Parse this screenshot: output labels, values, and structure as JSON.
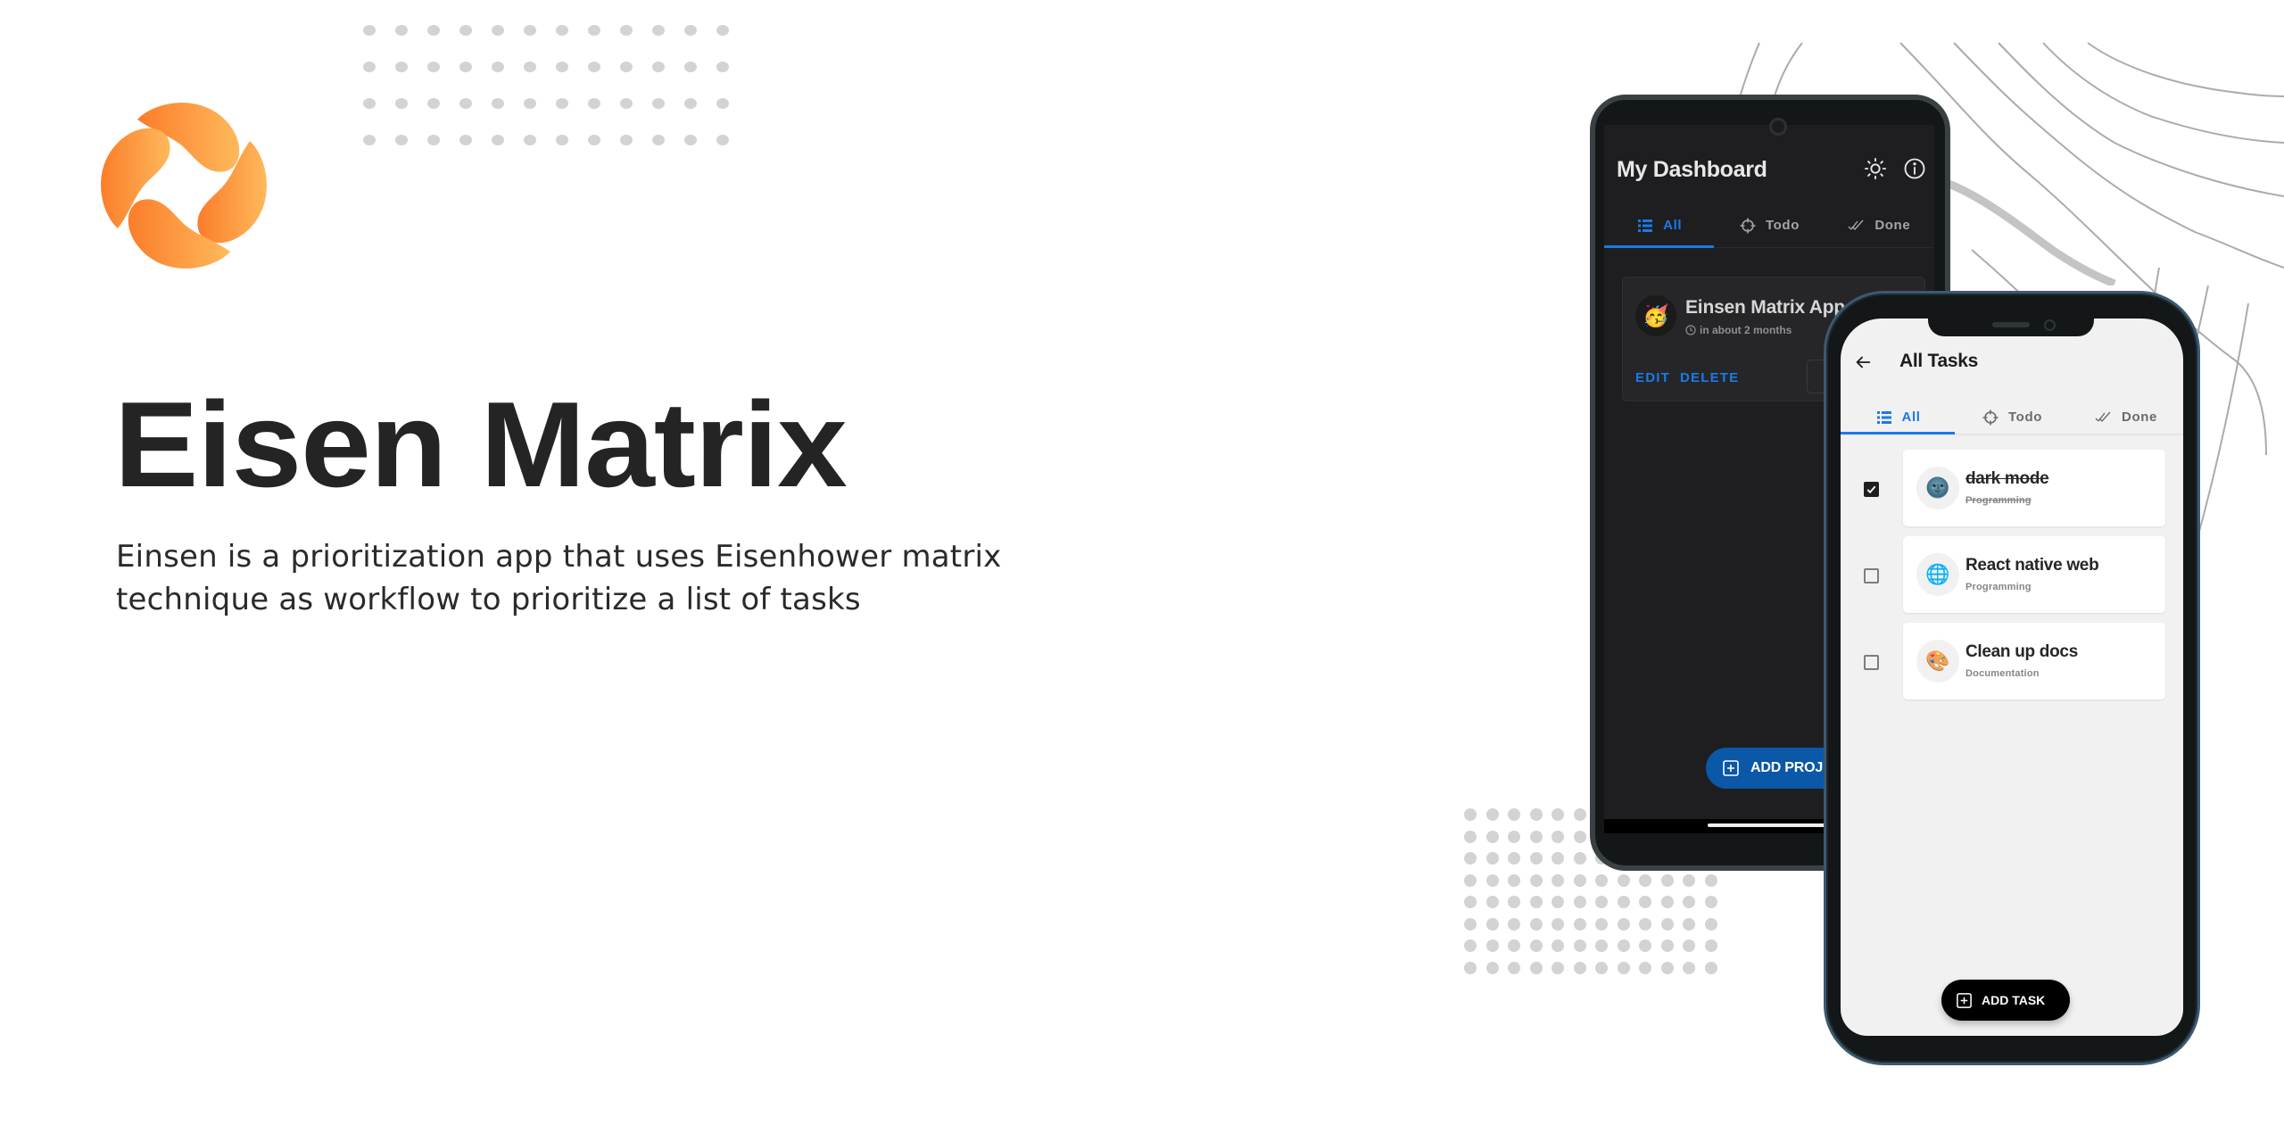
{
  "brand": {
    "title": "Eisen Matrix",
    "description_line1": "Einsen is a prioritization app that uses Eisenhower matrix",
    "description_line2": "technique as workflow to prioritize a list of tasks",
    "logo_icon": "petal-swirl-logo",
    "colors": {
      "logo_start": "#fb7d2a",
      "logo_end": "#ffb95c",
      "title": "#242424",
      "accent_blue": "#1a7ae8"
    }
  },
  "dark_phone": {
    "header": {
      "title": "My Dashboard",
      "theme_icon": "sun-icon",
      "info_icon": "info-icon"
    },
    "tabs": [
      {
        "label": "All",
        "icon": "list-icon",
        "active": true
      },
      {
        "label": "Todo",
        "icon": "crosshair-icon",
        "active": false
      },
      {
        "label": "Done",
        "icon": "double-check-icon",
        "active": false
      }
    ],
    "project": {
      "emoji": "🥳",
      "title": "Einsen Matrix App",
      "due": "in about 2 months",
      "edit_label": "EDIT",
      "delete_label": "DELETE"
    },
    "fab_label": "ADD PROJEC"
  },
  "light_phone": {
    "header": {
      "title": "All Tasks",
      "back_icon": "arrow-left-icon"
    },
    "tabs": [
      {
        "label": "All",
        "icon": "list-icon",
        "active": true
      },
      {
        "label": "Todo",
        "icon": "crosshair-icon",
        "active": false
      },
      {
        "label": "Done",
        "icon": "double-check-icon",
        "active": false
      }
    ],
    "tasks": [
      {
        "emoji": "🌚",
        "title": "dark mode",
        "category": "Programming",
        "done": true
      },
      {
        "emoji": "🌐",
        "title": "React native web",
        "category": "Programming",
        "done": false
      },
      {
        "emoji": "🎨",
        "title": "Clean up docs",
        "category": "Documentation",
        "done": false
      }
    ],
    "fab_label": "ADD TASK"
  }
}
